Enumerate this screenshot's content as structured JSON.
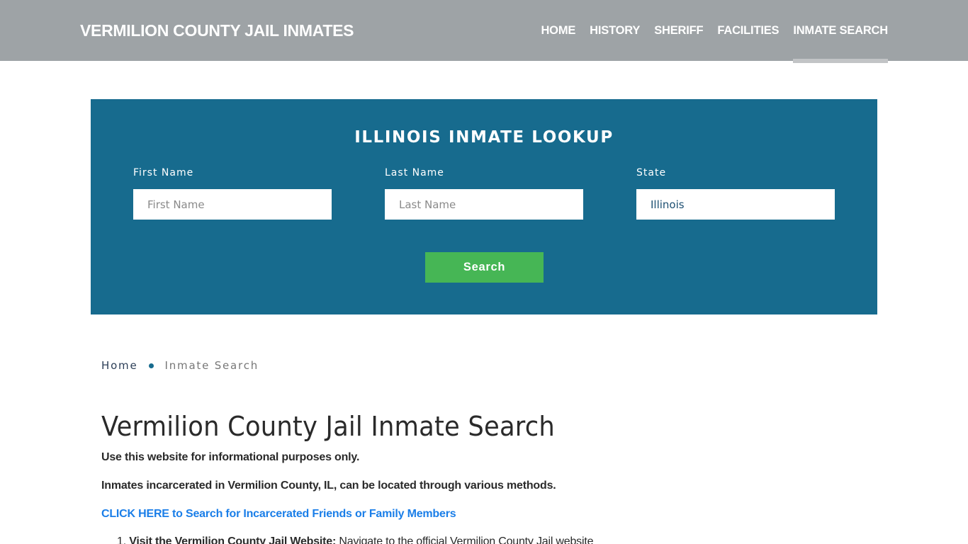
{
  "header": {
    "brand": "VERMILION COUNTY JAIL INMATES",
    "nav": [
      {
        "label": "HOME",
        "active": false
      },
      {
        "label": "HISTORY",
        "active": false
      },
      {
        "label": "SHERIFF",
        "active": false
      },
      {
        "label": "FACILITIES",
        "active": false
      },
      {
        "label": "INMATE SEARCH",
        "active": true
      }
    ]
  },
  "lookup": {
    "title": "ILLINOIS INMATE LOOKUP",
    "first_name": {
      "label": "First Name",
      "placeholder": "First Name",
      "value": ""
    },
    "last_name": {
      "label": "Last Name",
      "placeholder": "Last Name",
      "value": ""
    },
    "state": {
      "label": "State",
      "value": "Illinois"
    },
    "search_label": "Search",
    "colors": {
      "panel": "#176b8e",
      "button": "#46b655"
    }
  },
  "breadcrumb": {
    "home": "Home",
    "current": "Inmate Search"
  },
  "content": {
    "title": "Vermilion County Jail Inmate Search",
    "paragraph1": "Use this website for informational purposes only.",
    "paragraph2": "Inmates incarcerated in Vermilion County, IL, can be located through various methods.",
    "cta_link": "CLICK HERE to Search for Incarcerated Friends or Family Members",
    "list": [
      {
        "number": "1.",
        "title": "Visit the Vermilion County Jail Website:",
        "text": "Navigate to the official Vermilion County Jail website"
      }
    ]
  }
}
